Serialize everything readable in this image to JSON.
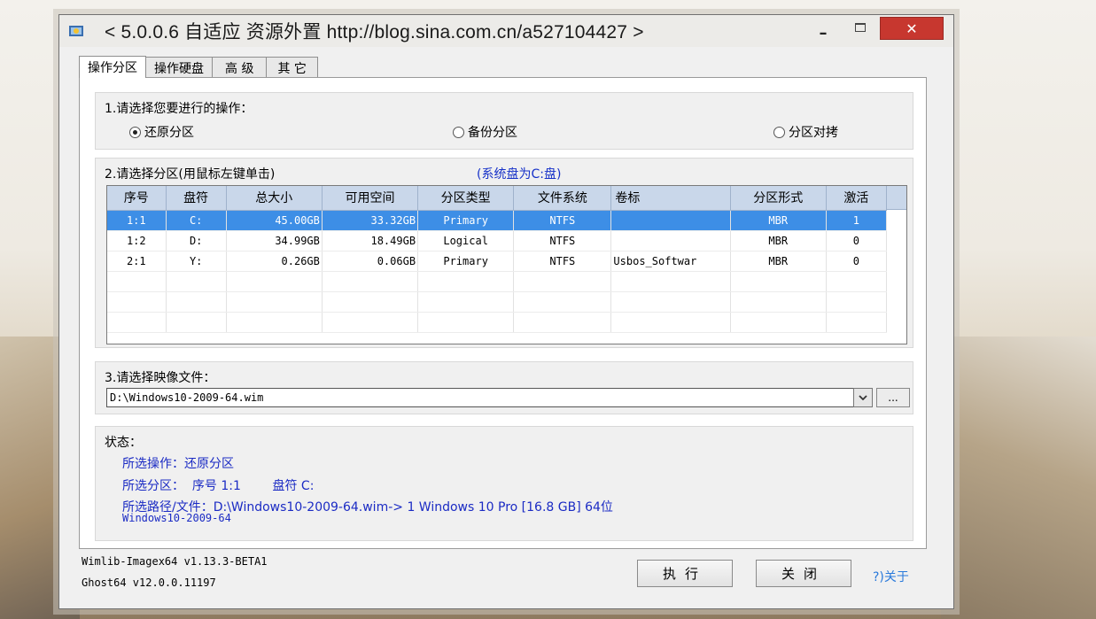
{
  "window": {
    "title": "< 5.0.0.6 自适应 资源外置 http://blog.sina.com.cn/a527104427 >",
    "minimize": "–",
    "close": "✕"
  },
  "tabs": [
    {
      "label": "操作分区",
      "active": true
    },
    {
      "label": "操作硬盘",
      "active": false
    },
    {
      "label": "高 级",
      "active": false
    },
    {
      "label": "其 它",
      "active": false
    }
  ],
  "operation": {
    "label": "1.请选择您要进行的操作：",
    "options": [
      "还原分区",
      "备份分区",
      "分区对拷"
    ],
    "selected": "还原分区"
  },
  "partition": {
    "label": "2.请选择分区(用鼠标左键单击)",
    "system_note": "(系统盘为C:盘)",
    "columns": [
      "序号",
      "盘符",
      "总大小",
      "可用空间",
      "分区类型",
      "文件系统",
      "卷标",
      "分区形式",
      "激活"
    ],
    "rows": [
      {
        "index": "1:1",
        "drive": "C:",
        "total": "45.00GB",
        "free": "33.32GB",
        "type": "Primary",
        "fs": "NTFS",
        "label": "",
        "scheme": "MBR",
        "active": "1",
        "selected": true
      },
      {
        "index": "1:2",
        "drive": "D:",
        "total": "34.99GB",
        "free": "18.49GB",
        "type": "Logical",
        "fs": "NTFS",
        "label": "",
        "scheme": "MBR",
        "active": "0",
        "selected": false
      },
      {
        "index": "2:1",
        "drive": "Y:",
        "total": "0.26GB",
        "free": "0.06GB",
        "type": "Primary",
        "fs": "NTFS",
        "label": "Usbos_Softwar",
        "scheme": "MBR",
        "active": "0",
        "selected": false
      }
    ]
  },
  "image": {
    "label": "3.请选择映像文件：",
    "value": "D:\\Windows10-2009-64.wim",
    "browse": "..."
  },
  "status": {
    "label": "状态：",
    "op": "所选操作：还原分区",
    "partition": "所选分区：  序号 1:1        盘符 C:",
    "path_line1": "所选路径/文件：D:\\Windows10-2009-64.wim-> 1 Windows 10 Pro [16.8 GB] 64位",
    "path_line2": "Windows10-2009-64"
  },
  "footer": {
    "version1": "Wimlib-Imagex64 v1.13.3-BETA1",
    "version2": "Ghost64 v12.0.0.11197",
    "execute": "执行",
    "close": "关闭",
    "about": "?)关于"
  }
}
